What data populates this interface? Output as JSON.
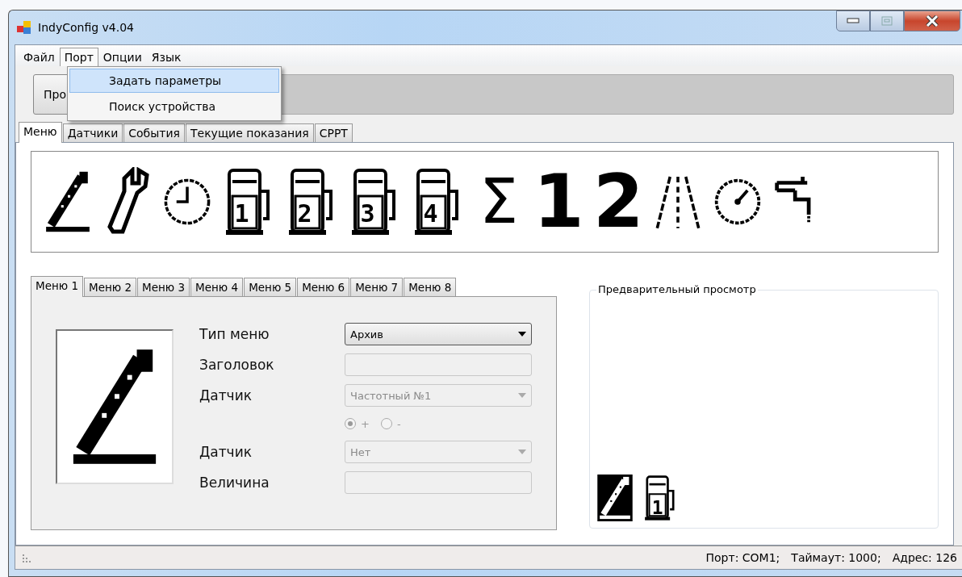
{
  "window": {
    "title": "IndyConfig v4.04"
  },
  "menu_bar": [
    {
      "label": "Файл",
      "selected": false
    },
    {
      "label": "Порт",
      "selected": true
    },
    {
      "label": "Опции",
      "selected": false
    },
    {
      "label": "Язык",
      "selected": false
    }
  ],
  "port_menu": [
    {
      "label": "Задать параметры",
      "selected": true
    },
    {
      "label": "Поиск устройства",
      "selected": false
    }
  ],
  "toolbar": {
    "button": "Про",
    "progress": {
      "level": 0
    }
  },
  "tabs": [
    {
      "label": "Меню",
      "selected": true
    },
    {
      "label": "Датчики",
      "selected": false
    },
    {
      "label": "События",
      "selected": false
    },
    {
      "label": "Текущие показания",
      "selected": false
    },
    {
      "label": "CPPT",
      "selected": false
    }
  ],
  "icon_palette": [
    {
      "kind": "pen"
    },
    {
      "kind": "wrench"
    },
    {
      "kind": "clock"
    },
    {
      "kind": "pump",
      "label": "1"
    },
    {
      "kind": "pump",
      "label": "2"
    },
    {
      "kind": "pump",
      "label": "3"
    },
    {
      "kind": "pump",
      "label": "4"
    },
    {
      "kind": "glyph",
      "label": "Σ"
    },
    {
      "kind": "glyph",
      "label": "1"
    },
    {
      "kind": "glyph",
      "label": "2"
    },
    {
      "kind": "road"
    },
    {
      "kind": "gauge"
    },
    {
      "kind": "tap"
    }
  ],
  "menu_tabs": [
    {
      "label": "Меню 1",
      "selected": true
    },
    {
      "label": "Меню 2",
      "selected": false
    },
    {
      "label": "Меню 3",
      "selected": false
    },
    {
      "label": "Меню 4",
      "selected": false
    },
    {
      "label": "Меню 5",
      "selected": false
    },
    {
      "label": "Меню 6",
      "selected": false
    },
    {
      "label": "Меню 7",
      "selected": false
    },
    {
      "label": "Меню 8",
      "selected": false
    }
  ],
  "menu_image": {
    "kind": "pen"
  },
  "fields": [
    {
      "kind": "dropdown",
      "label": "Тип меню",
      "value": "Архив",
      "disabled": false
    },
    {
      "kind": "text",
      "label": "Заголовок",
      "disabled": true
    },
    {
      "kind": "dropdown",
      "label": "Датчик",
      "value": "Частотный №1",
      "disabled": true
    },
    {
      "kind": "radio",
      "disabled": true,
      "options": [
        {
          "label": "+",
          "selected": true
        },
        {
          "label": "-",
          "selected": false
        }
      ]
    },
    {
      "kind": "dropdown",
      "label": "Датчик",
      "value": "Нет",
      "disabled": true
    },
    {
      "kind": "text",
      "label": "Величина",
      "disabled": true
    }
  ],
  "preview": {
    "title": "Предварительный просмотр",
    "icons": [
      {
        "kind": "pen",
        "selected": true
      },
      {
        "kind": "pump",
        "label": "1",
        "selected": false
      }
    ]
  },
  "status_bar": [
    "Порт: COM1;",
    "Таймаут: 1000;",
    "Адрес: 126"
  ]
}
